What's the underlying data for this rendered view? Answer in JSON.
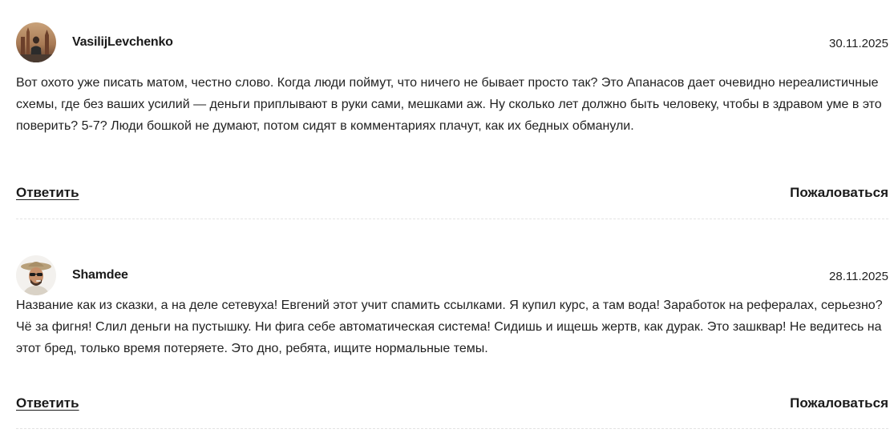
{
  "comments": [
    {
      "author": "VasilijLevchenko",
      "date": "30.11.2025",
      "text": "Вот охото уже писать матом, честно слово. Когда люди поймут, что ничего не бывает просто так? Это Апанасов дает очевидно нереалистичные схемы, где без ваших усилий — деньги приплывают в руки сами, мешками аж. Ну сколько лет должно быть человеку, чтобы в здравом уме в это поверить? 5-7? Люди бошкой не думают, потом сидят в комментариях плачут, как их бедных обманули.",
      "reply_label": "Ответить",
      "report_label": "Пожаловаться",
      "avatar_icon": "user-photo-avatar"
    },
    {
      "author": "Shamdee",
      "date": "28.11.2025",
      "text": "Название как из сказки, а на деле сетевуха! Евгений этот учит спамить ссылками. Я купил курс, а там вода! Заработок на рефералах, серьезно? Чё за фигня! Слил деньги на пустышку. Ни фига себе автоматическая система! Сидишь и ищешь жертв, как дурак. Это зашквар! Не ведитесь на этот бред, только время потеряете. Это дно, ребята, ищите нормальные темы.",
      "reply_label": "Ответить",
      "report_label": "Пожаловаться",
      "avatar_icon": "user-photo-avatar"
    }
  ],
  "colors": {
    "text": "#222222",
    "divider": "#e3e3e3",
    "background": "#ffffff"
  }
}
